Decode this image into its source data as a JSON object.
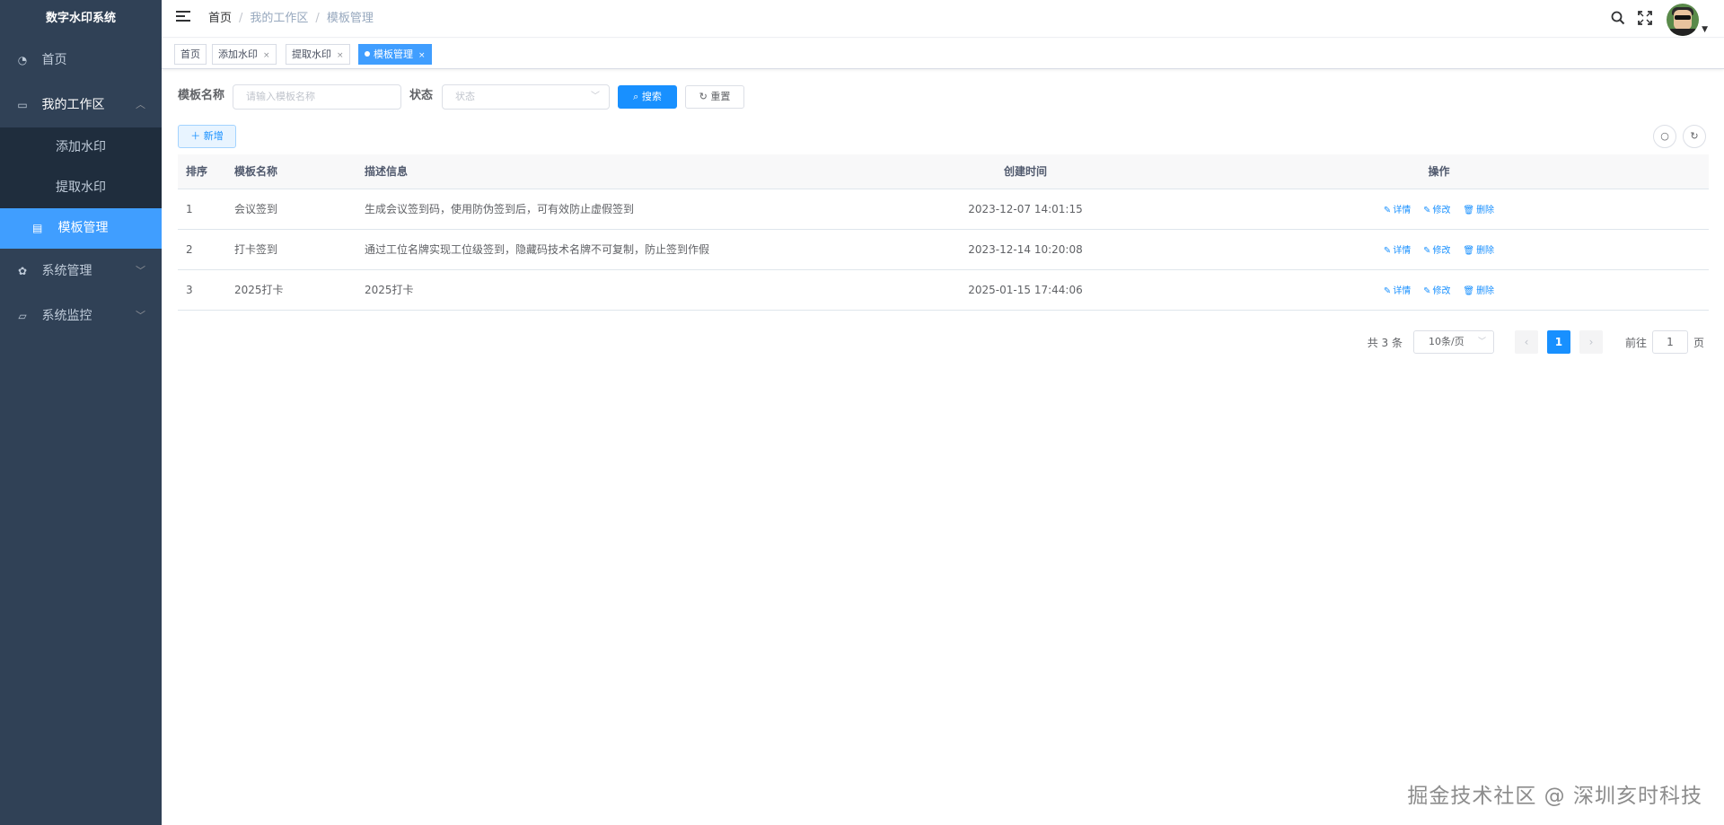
{
  "app": {
    "title": "数字水印系统"
  },
  "sidebar": {
    "items": [
      {
        "label": "首页",
        "icon": "dashboard-icon"
      },
      {
        "label": "我的工作区",
        "icon": "monitor-icon",
        "sub": [
          "添加水印",
          "提取水印",
          "模板管理"
        ]
      },
      {
        "label": "系统管理",
        "icon": "gear-icon"
      },
      {
        "label": "系统监控",
        "icon": "chart-monitor-icon"
      }
    ],
    "active_sub": "模板管理"
  },
  "breadcrumb": [
    "首页",
    "我的工作区",
    "模板管理"
  ],
  "tags": [
    {
      "label": "首页",
      "closable": false,
      "active": false
    },
    {
      "label": "添加水印",
      "closable": true,
      "active": false
    },
    {
      "label": "提取水印",
      "closable": true,
      "active": false
    },
    {
      "label": "模板管理",
      "closable": true,
      "active": true
    }
  ],
  "search": {
    "name_label": "模板名称",
    "name_placeholder": "请输入模板名称",
    "status_label": "状态",
    "status_placeholder": "状态",
    "search_button": "搜索",
    "reset_button": "重置"
  },
  "toolbar": {
    "add_button": "新增"
  },
  "table": {
    "headers": [
      "排序",
      "模板名称",
      "描述信息",
      "创建时间",
      "操作"
    ],
    "rows": [
      {
        "order": "1",
        "name": "会议签到",
        "desc": "生成会议签到码，使用防伪签到后，可有效防止虚假签到",
        "created": "2023-12-07 14:01:15"
      },
      {
        "order": "2",
        "name": "打卡签到",
        "desc": "通过工位名牌实现工位级签到，隐藏码技术名牌不可复制，防止签到作假",
        "created": "2023-12-14 10:20:08"
      },
      {
        "order": "3",
        "name": "2025打卡",
        "desc": "2025打卡",
        "created": "2025-01-15 17:44:06"
      }
    ],
    "actions": [
      "详情",
      "修改",
      "删除"
    ]
  },
  "pagination": {
    "total_text": "共 3 条",
    "page_size": "10条/页",
    "current_page": "1",
    "goto_label": "前往",
    "goto_value": "1",
    "page_suffix": "页"
  },
  "watermark": "掘金技术社区 @ 深圳亥时科技",
  "colors": {
    "sidebar_bg": "#304156",
    "primary": "#1890ff",
    "active_menu": "#409eff"
  }
}
